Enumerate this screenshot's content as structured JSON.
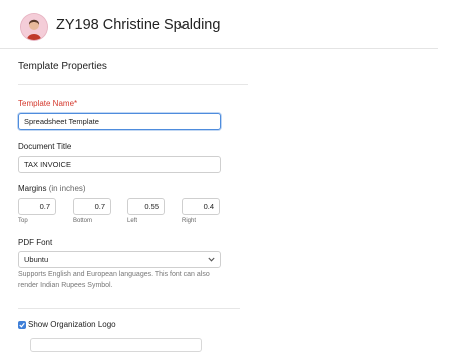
{
  "header": {
    "account_name": "ZY198 Christine Spalding"
  },
  "section_title": "Template Properties",
  "fields": {
    "template_name": {
      "label": "Template Name*",
      "value": "Spreadsheet Template"
    },
    "document_title": {
      "label": "Document Title",
      "value": "TAX INVOICE"
    },
    "margins": {
      "label": "Margins",
      "unit": "(in inches)",
      "top": {
        "value": "0.7",
        "label": "Top"
      },
      "bottom": {
        "value": "0.7",
        "label": "Bottom"
      },
      "left": {
        "value": "0.55",
        "label": "Left"
      },
      "right": {
        "value": "0.4",
        "label": "Right"
      }
    },
    "pdf_font": {
      "label": "PDF Font",
      "selected": "Ubuntu",
      "helper_text": "Supports English and European languages. This font can also render Indian Rupees Symbol."
    },
    "show_org_logo": {
      "label": "Show Organization Logo",
      "checked": true
    }
  },
  "colors": {
    "accent": "#4e8cdd",
    "required": "#d4382c",
    "checkbox": "#3f7fd8"
  },
  "icons": {
    "account_dropdown": "chevron-down-icon",
    "select_dropdown": "chevron-down-icon",
    "checkbox": "check-icon"
  }
}
